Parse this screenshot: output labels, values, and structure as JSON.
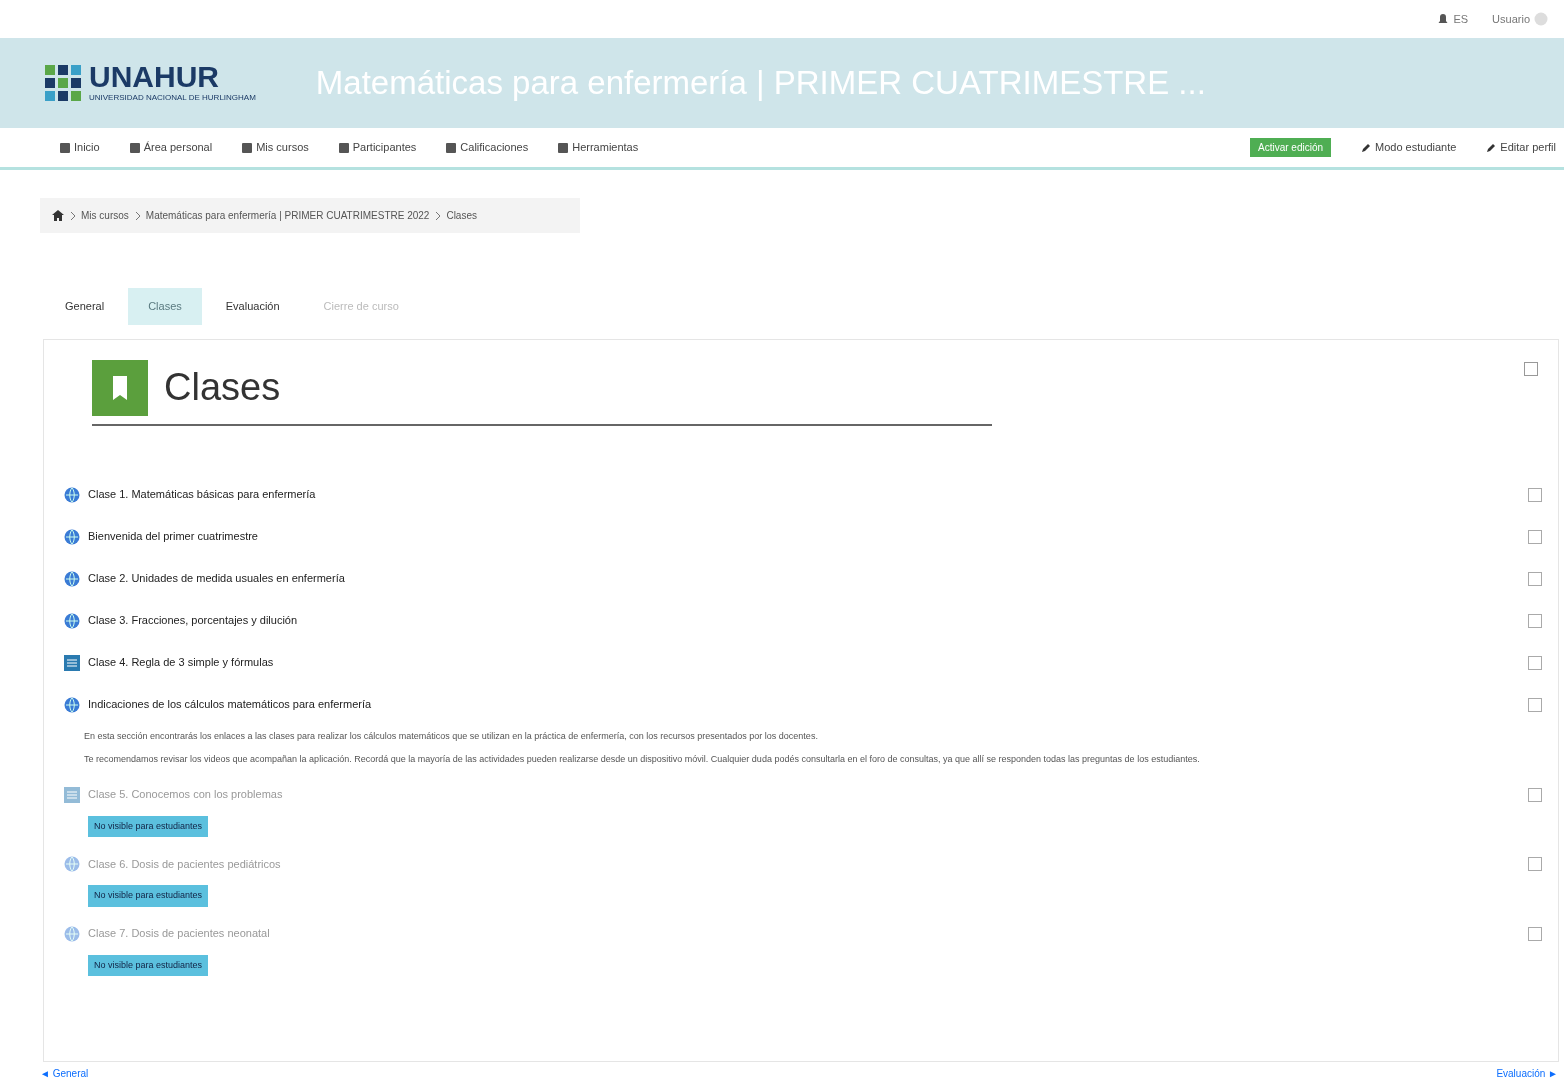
{
  "top_bar": {
    "language": "ES",
    "user": "Usuario"
  },
  "header": {
    "logo": "UNAHUR",
    "logo_subtitle": "UNIVERSIDAD NACIONAL DE HURLINGHAM",
    "course_title": "Matemáticas para enfermería | PRIMER CUATRIMESTRE ..."
  },
  "nav": {
    "items": [
      "Inicio",
      "Área personal",
      "Mis cursos",
      "Participantes",
      "Calificaciones",
      "Herramientas"
    ],
    "actions": [
      {
        "label": "Activar edición",
        "kind": "primary"
      },
      {
        "label": "Modo estudiante",
        "kind": "link"
      },
      {
        "label": "Editar perfil",
        "kind": "link"
      }
    ]
  },
  "breadcrumb": [
    "Mis cursos",
    "Matemáticas para enfermería | PRIMER CUATRIMESTRE 2022",
    "Clases"
  ],
  "tabs": [
    {
      "label": "General",
      "selected": false,
      "disabled": false
    },
    {
      "label": "Clases",
      "selected": true,
      "disabled": false
    },
    {
      "label": "Evaluación",
      "selected": false,
      "disabled": false
    },
    {
      "label": "Cierre de curso",
      "selected": false,
      "disabled": true
    }
  ],
  "section": {
    "title": "Clases",
    "items": [
      {
        "kind": "url",
        "title": "Clase 1. Matemáticas básicas para enfermería",
        "hidden": false
      },
      {
        "kind": "url",
        "title": "Bienvenida del primer cuatrimestre",
        "hidden": false
      },
      {
        "kind": "url",
        "title": "Clase 2. Unidades de medida usuales en enfermería",
        "hidden": false
      },
      {
        "kind": "url",
        "title": "Clase 3. Fracciones, porcentajes y dilución",
        "hidden": false
      },
      {
        "kind": "page",
        "title": "Clase 4. Regla de 3 simple y fórmulas",
        "hidden": false
      },
      {
        "kind": "url",
        "title": "Indicaciones de los cálculos matemáticos para enfermería",
        "hidden": false,
        "description": [
          "En esta sección encontrarás los enlaces a las clases para realizar los cálculos matemáticos que se utilizan en la práctica de enfermería, con los recursos presentados por los docentes.",
          "Te recomendamos revisar los videos que acompañan la aplicación. Recordá que la mayoría de las actividades pueden realizarse desde un dispositivo móvil. Cualquier duda podés consultarla en el foro de consultas, ya que allí se responden todas las preguntas de los estudiantes."
        ]
      },
      {
        "kind": "page",
        "title": "Clase 5. Conocemos con los problemas",
        "hidden": true,
        "badge": "No visible para estudiantes"
      },
      {
        "kind": "url",
        "title": "Clase 6. Dosis de pacientes pediátricos",
        "hidden": true,
        "badge": "No visible para estudiantes"
      },
      {
        "kind": "url",
        "title": "Clase 7. Dosis de pacientes neonatal",
        "hidden": true,
        "badge": "No visible para estudiantes"
      }
    ]
  },
  "footer": {
    "previous": "◄ General",
    "next": "Evaluación ►"
  }
}
